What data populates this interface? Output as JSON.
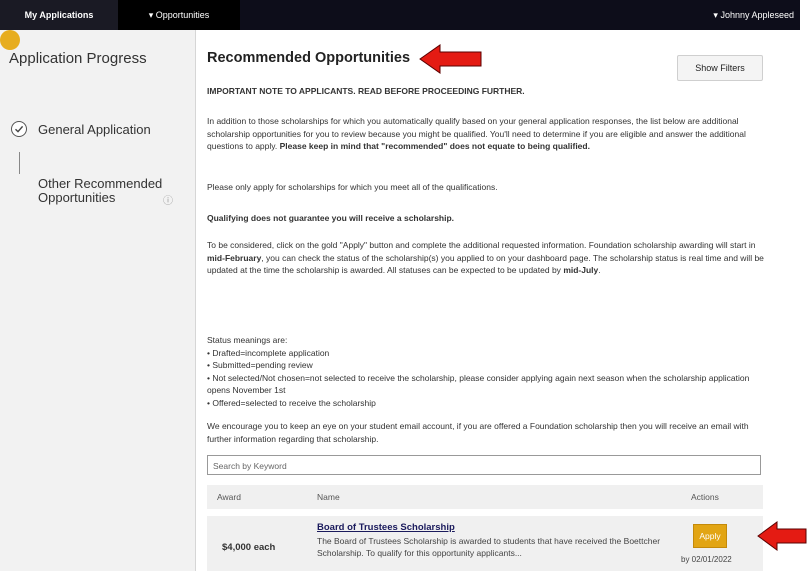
{
  "nav": {
    "tab_myapps": "My Applications",
    "tab_opps": "▾ Opportunities",
    "user": "▾ Johnny Appleseed"
  },
  "sidebar": {
    "title": "Application Progress",
    "steps": [
      {
        "label": "General Application",
        "state": "complete"
      },
      {
        "label": "Other Recommended Opportunities",
        "state": "current"
      }
    ]
  },
  "main": {
    "title": "Recommended Opportunities",
    "show_filters": "Show Filters",
    "important_note": "IMPORTANT NOTE TO APPLICANTS. READ BEFORE PROCEEDING FURTHER.",
    "p1": "In addition to those scholarships for which you automatically qualify based on your general application responses, the list below are additional scholarship opportunities for you to review because you might be qualified. You'll need to determine if you are eligible and answer the additional questions to apply.",
    "p1_bold": "Please keep in mind that \"recommended\" does not equate to being qualified.",
    "p2": "Please only apply for scholarships for which you meet all of the qualifications.",
    "p3": "Qualifying does not guarantee you will receive a scholarship.",
    "p4_a": "To be considered, click on the gold \"Apply\" button and complete the additional requested information. Foundation scholarship awarding will start in",
    "p4_b": "mid-February",
    "p4_c": ", you can check the status of the scholarship(s) you applied to on your dashboard page. The scholarship status is real time and will be updated at the time the scholarship is awarded. All statuses can be expected to be updated by",
    "p4_d": "mid-July",
    "p4_e": ".",
    "status_heading": "Status meanings are:",
    "statuses": [
      "• Drafted=incomplete application",
      "• Submitted=pending review",
      "• Not selected/Not chosen=not selected to receive the scholarship, please consider applying again next season when the scholarship application opens November 1st",
      "• Offered=selected to receive the scholarship"
    ],
    "p6": "We encourage you to keep an eye on your student email account, if you are offered a Foundation scholarship then you will receive an email with further information regarding that scholarship.",
    "search_placeholder": "Search by Keyword",
    "table": {
      "headers": [
        "Award",
        "Name",
        "Actions"
      ],
      "rows": [
        {
          "award": "$4,000 each",
          "name": "Board of Trustees Scholarship",
          "description": "The Board of Trustees Scholarship is awarded to students that have received the Boettcher Scholarship. To qualify for this opportunity applicants...",
          "action": "Apply",
          "deadline": "by 02/01/2022"
        }
      ]
    }
  },
  "colors": {
    "nav_bg": "#0d0d1a",
    "gold": "#e2a514",
    "arrow": "#e41b13"
  }
}
